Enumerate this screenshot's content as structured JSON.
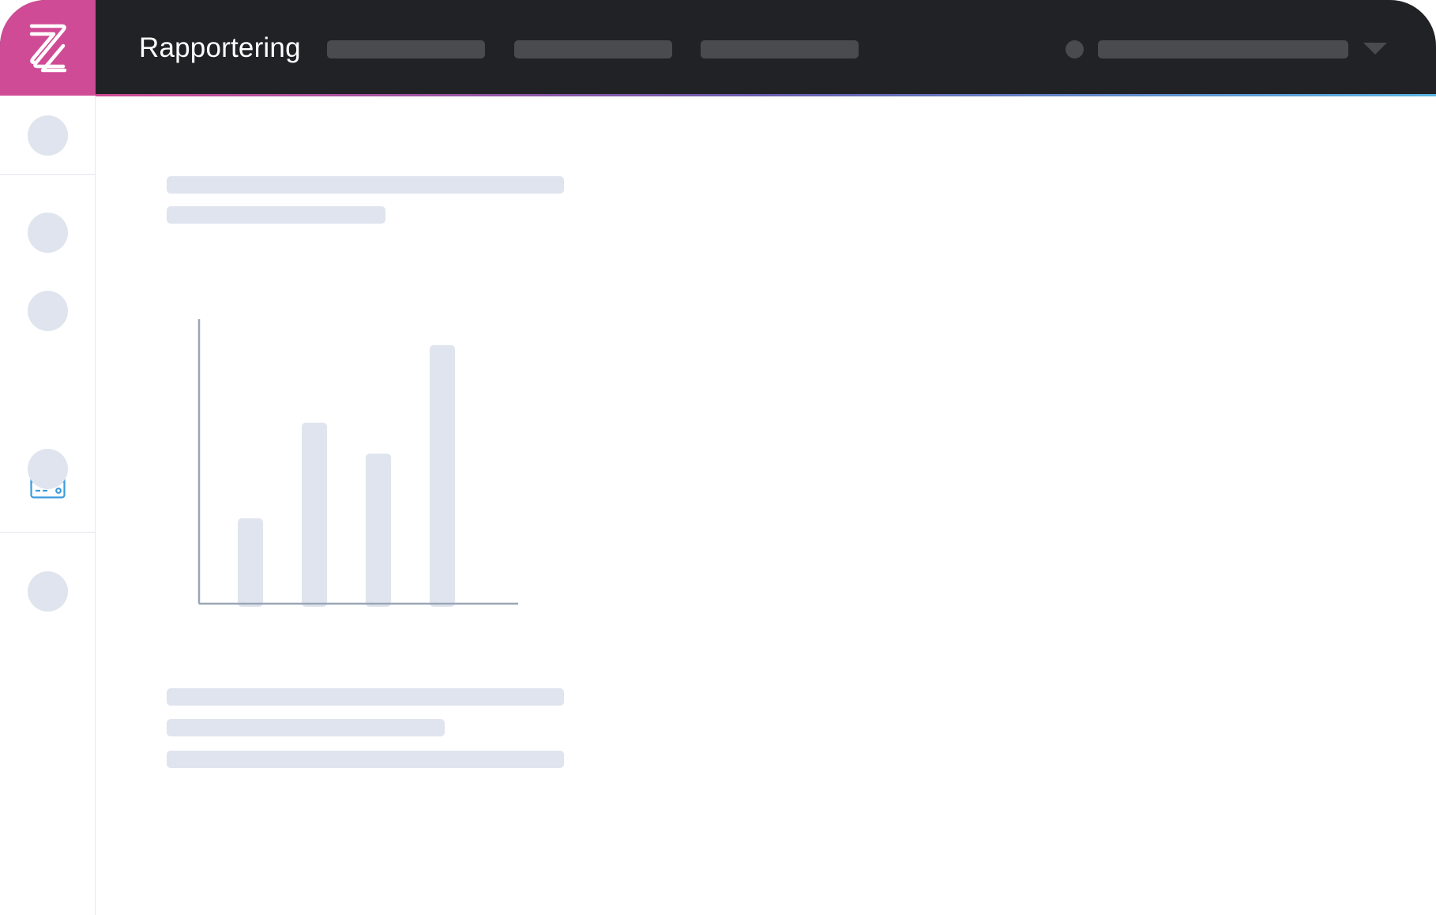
{
  "header": {
    "title": "Rapportering",
    "logo_icon": "zettle-z-logo-icon",
    "nav_placeholders": 3,
    "user_avatar": "user-avatar-placeholder",
    "dropdown_icon": "chevron-down-icon"
  },
  "sidebar": {
    "items": [
      {
        "icon": "placeholder-circle-icon",
        "active": false
      },
      {
        "icon": "placeholder-circle-icon",
        "active": false
      },
      {
        "icon": "placeholder-circle-icon",
        "active": false
      },
      {
        "icon": "credit-card-icon",
        "active": true
      },
      {
        "icon": "placeholder-circle-icon",
        "active": false
      },
      {
        "icon": "placeholder-circle-icon",
        "active": false
      }
    ]
  },
  "colors": {
    "brand": "#d04b95",
    "topbar": "#212226",
    "skeleton": "#dfe4ee",
    "active_icon": "#3a9be0",
    "axis": "#9aa6b6"
  },
  "chart_data": {
    "type": "bar",
    "categories": [
      "",
      "",
      "",
      ""
    ],
    "values": [
      33,
      70,
      58,
      100
    ],
    "ylim": [
      0,
      110
    ],
    "title": "",
    "xlabel": "",
    "ylabel": "",
    "grid": false
  }
}
